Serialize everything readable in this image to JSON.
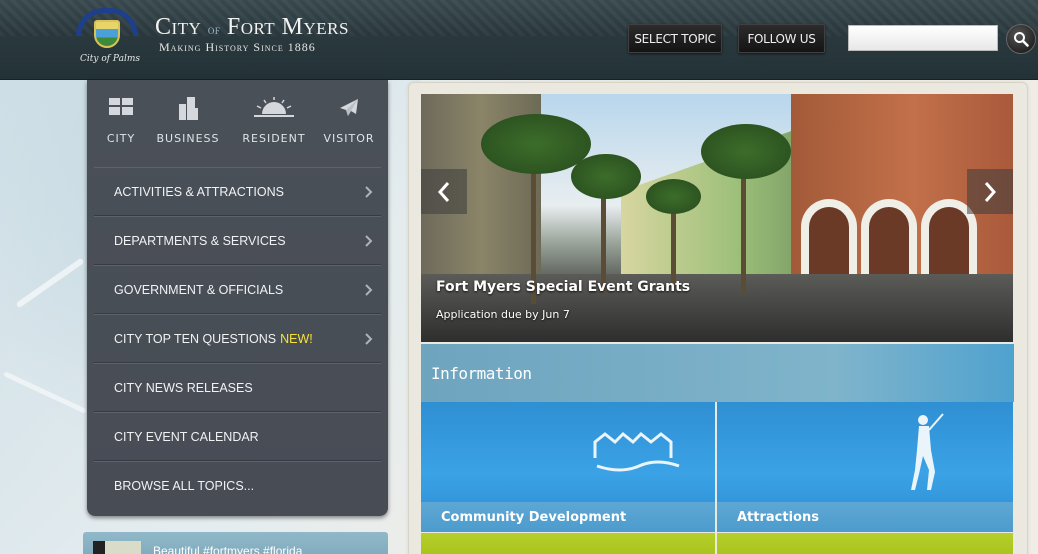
{
  "header": {
    "title_city": "City",
    "title_of": "of",
    "title_name": "Fort Myers",
    "subtitle": "Making History Since 1886",
    "seal_text": "City of Palms",
    "select_topic_label": "SELECT TOPIC",
    "follow_us_label": "FOLLOW US",
    "search_value": ""
  },
  "audiences": [
    {
      "label": "CITY",
      "icon": "city-grid-icon"
    },
    {
      "label": "BUSINESS",
      "icon": "buildings-icon"
    },
    {
      "label": "RESIDENT",
      "icon": "sunrise-icon"
    },
    {
      "label": "VISITOR",
      "icon": "airplane-icon"
    }
  ],
  "nav": [
    {
      "label": "ACTIVITIES & ATTRACTIONS",
      "new": "",
      "arrow": true
    },
    {
      "label": "DEPARTMENTS & SERVICES",
      "new": "",
      "arrow": true
    },
    {
      "label": "GOVERNMENT & OFFICIALS",
      "new": "",
      "arrow": true
    },
    {
      "label": "CITY TOP TEN QUESTIONS",
      "new": "NEW!",
      "arrow": true
    },
    {
      "label": "CITY NEWS RELEASES",
      "new": "",
      "arrow": false
    },
    {
      "label": "CITY EVENT CALENDAR",
      "new": "",
      "arrow": false
    },
    {
      "label": "BROWSE ALL TOPICS...",
      "new": "",
      "arrow": false
    }
  ],
  "social": {
    "text": "Beautiful #fortmyers #florida"
  },
  "slider": {
    "title": "Fort Myers Special Event Grants",
    "subtitle": "Application due by Jun 7"
  },
  "info": {
    "heading": "Information",
    "tiles": [
      {
        "label": "Community Development",
        "icon": "houses-water-icon"
      },
      {
        "label": "Attractions",
        "icon": "golfer-icon"
      }
    ]
  },
  "colors": {
    "header_bg": "#2a393e",
    "nav_bg": "#4a5058",
    "new_badge": "#f5e33a",
    "info_bar": "#7fb4cb",
    "tile_blue": "#3ba2e6",
    "tile_green": "#b6cf2b"
  }
}
